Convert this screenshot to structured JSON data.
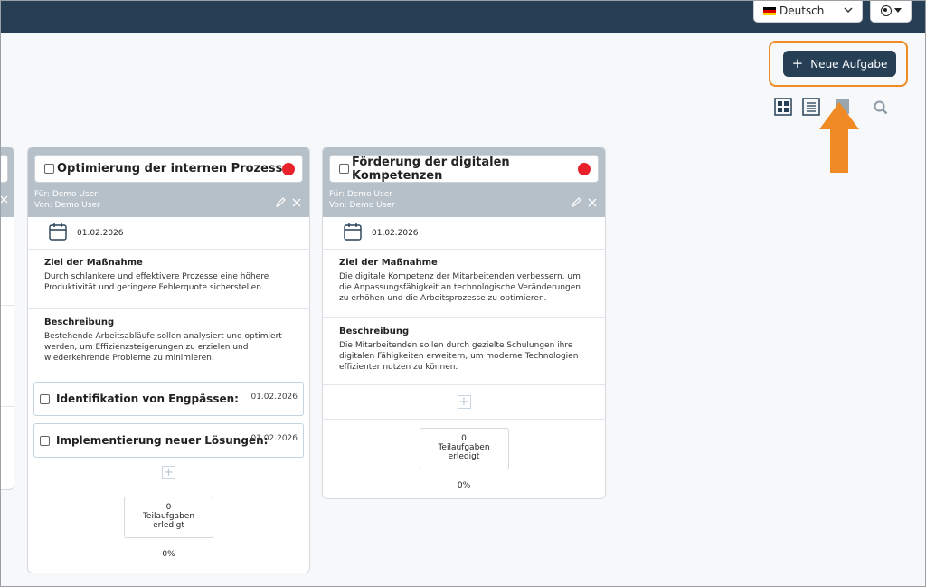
{
  "header": {
    "language": "Deutsch",
    "new_task_label": "Neue Aufgabe"
  },
  "cards": [
    {
      "title": "Optimierung der internen Prozesse",
      "for_user": "Für: Demo User",
      "from_user": "Von: Demo User",
      "date": "01.02.2026",
      "goal_heading": "Ziel der Maßnahme",
      "goal_text": "Durch schlankere und effektivere Prozesse eine höhere Produktivität und geringere Fehlerquote sicherstellen.",
      "desc_heading": "Beschreibung",
      "desc_text": "Bestehende Arbeitsabläufe sollen analysiert und optimiert werden, um Effizienzsteigerungen zu erzielen und wiederkehrende Probleme zu minimieren.",
      "subtasks": [
        {
          "label": "Identifikation von Engpässen:",
          "date": "01.02.2026"
        },
        {
          "label": "Implementierung neuer Lösungen:",
          "date": "01.02.2026"
        }
      ],
      "done_count": "0",
      "done_label_1": "Teilaufgaben",
      "done_label_2": "erledigt",
      "percent": "0%"
    },
    {
      "title": "Förderung der digitalen Kompetenzen",
      "for_user": "Für: Demo User",
      "from_user": "Von: Demo User",
      "date": "01.02.2026",
      "goal_heading": "Ziel der Maßnahme",
      "goal_text": "Die digitale Kompetenz der Mitarbeitenden verbessern, um die Anpassungsfähigkeit an technologische Veränderungen zu erhöhen und die Arbeitsprozesse zu optimieren.",
      "desc_heading": "Beschreibung",
      "desc_text": "Die Mitarbeitenden sollen durch gezielte Schulungen ihre digitalen Fähigkeiten erweitern, um moderne Technologien effizienter nutzen zu können.",
      "subtasks": [],
      "done_count": "0",
      "done_label_1": "Teilaufgaben",
      "done_label_2": "erledigt",
      "percent": "0%"
    }
  ],
  "colors": {
    "topbar": "#263f55",
    "accent": "#263f55",
    "highlight": "#f08a24",
    "priority": "#e8212b",
    "card_header": "#b5c0c9"
  },
  "icons": [
    "grid-view-icon",
    "list-view-icon",
    "archive-icon",
    "search-icon",
    "calendar-icon",
    "pencil-icon",
    "close-icon",
    "plus-icon",
    "arrow-up-icon",
    "user-icon"
  ]
}
